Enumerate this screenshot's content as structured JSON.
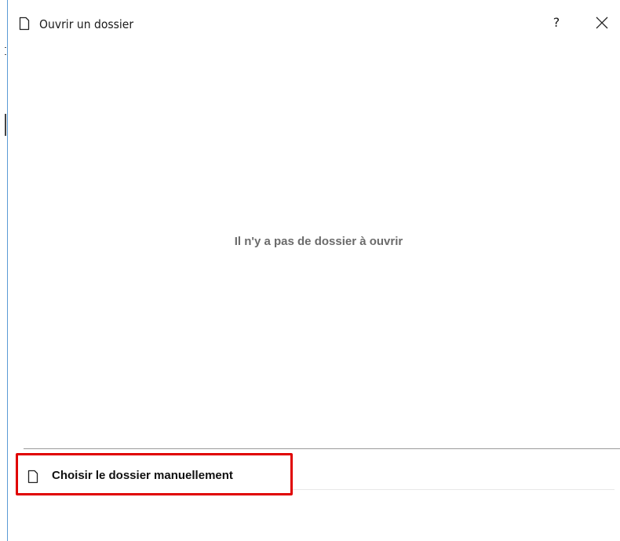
{
  "window": {
    "title": "Ouvrir un dossier",
    "help_label": "?",
    "title_icon": "document-icon",
    "close_icon": "close-icon"
  },
  "main": {
    "empty_message": "Il n'y a pas de dossier à ouvrir"
  },
  "actions": {
    "manual_label": "Choisir le dossier manuellement",
    "manual_icon": "document-icon"
  },
  "colors": {
    "highlight_border": "#e00000",
    "window_border": "#5b9bd5",
    "empty_text": "#6b6b6b"
  }
}
